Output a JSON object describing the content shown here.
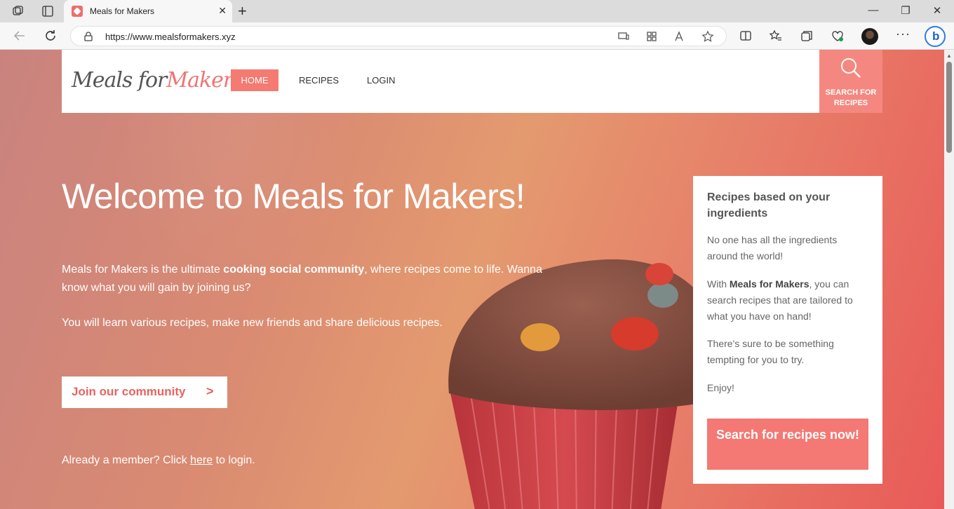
{
  "browser": {
    "tab_title": "Meals for Makers",
    "url": "https://www.mealsformakers.xyz"
  },
  "header": {
    "logo_meals": "Meals for",
    "logo_makers": "Makers",
    "nav": [
      "HOME",
      "RECIPES",
      "LOGIN"
    ],
    "search_label": "SEARCH FOR RECIPES"
  },
  "hero": {
    "title": "Welcome to Meals for Makers!",
    "intro_before": "Meals for Makers is the ultimate ",
    "intro_bold": "cooking social community",
    "intro_after": ", where recipes come to life. Wanna know what you will gain by joining us?",
    "second_line": "You will learn various recipes, make new friends and share delicious recipes.",
    "join_button": "Join our community",
    "login_before": "Already a member? Click ",
    "login_link": "here",
    "login_after": " to login."
  },
  "panel": {
    "title": "Recipes based on your ingredients",
    "p1": "No one has all the ingredients around the world!",
    "p2_before": "With ",
    "p2_bold": "Meals for Makers",
    "p2_after": ", you can search recipes that are tailored to what you have on hand!",
    "p3": "There's sure to be something tempting for you to try.",
    "p4": "Enjoy!",
    "button": "Search for recipes now!"
  },
  "colors": {
    "accent": "#f47873",
    "hero_text": "#ffffff"
  }
}
